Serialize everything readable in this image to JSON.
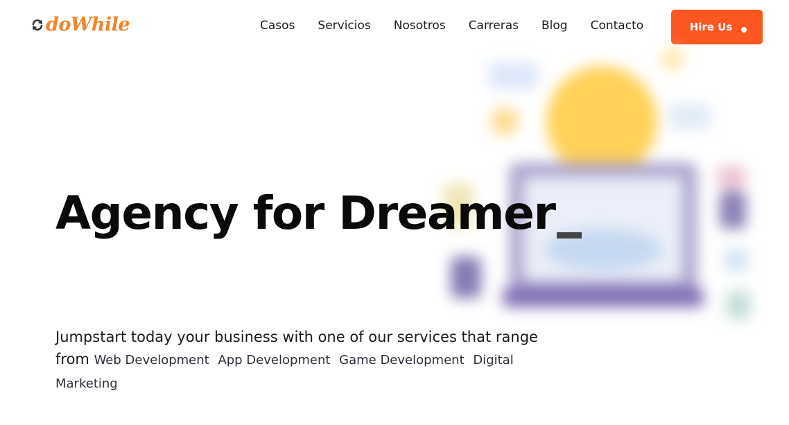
{
  "brand": {
    "logo_text": "doWhile",
    "logo_icon": "refresh-icon",
    "brand_color": "#f2832a"
  },
  "nav": {
    "items": [
      {
        "label": "Casos"
      },
      {
        "label": "Servicios"
      },
      {
        "label": "Nosotros"
      },
      {
        "label": "Carreras"
      },
      {
        "label": "Blog"
      },
      {
        "label": "Contacto"
      }
    ]
  },
  "cta": {
    "label": "Hire Us",
    "color": "#fe5621"
  },
  "hero": {
    "headline": "Agency for Dreamer",
    "intro": "Jumpstart today your business with one of our services that range from",
    "services": [
      "Web Development",
      "App Development",
      "Game Development",
      "Digital Marketing"
    ],
    "illustration": "laptop-lightbulb-illustration"
  }
}
